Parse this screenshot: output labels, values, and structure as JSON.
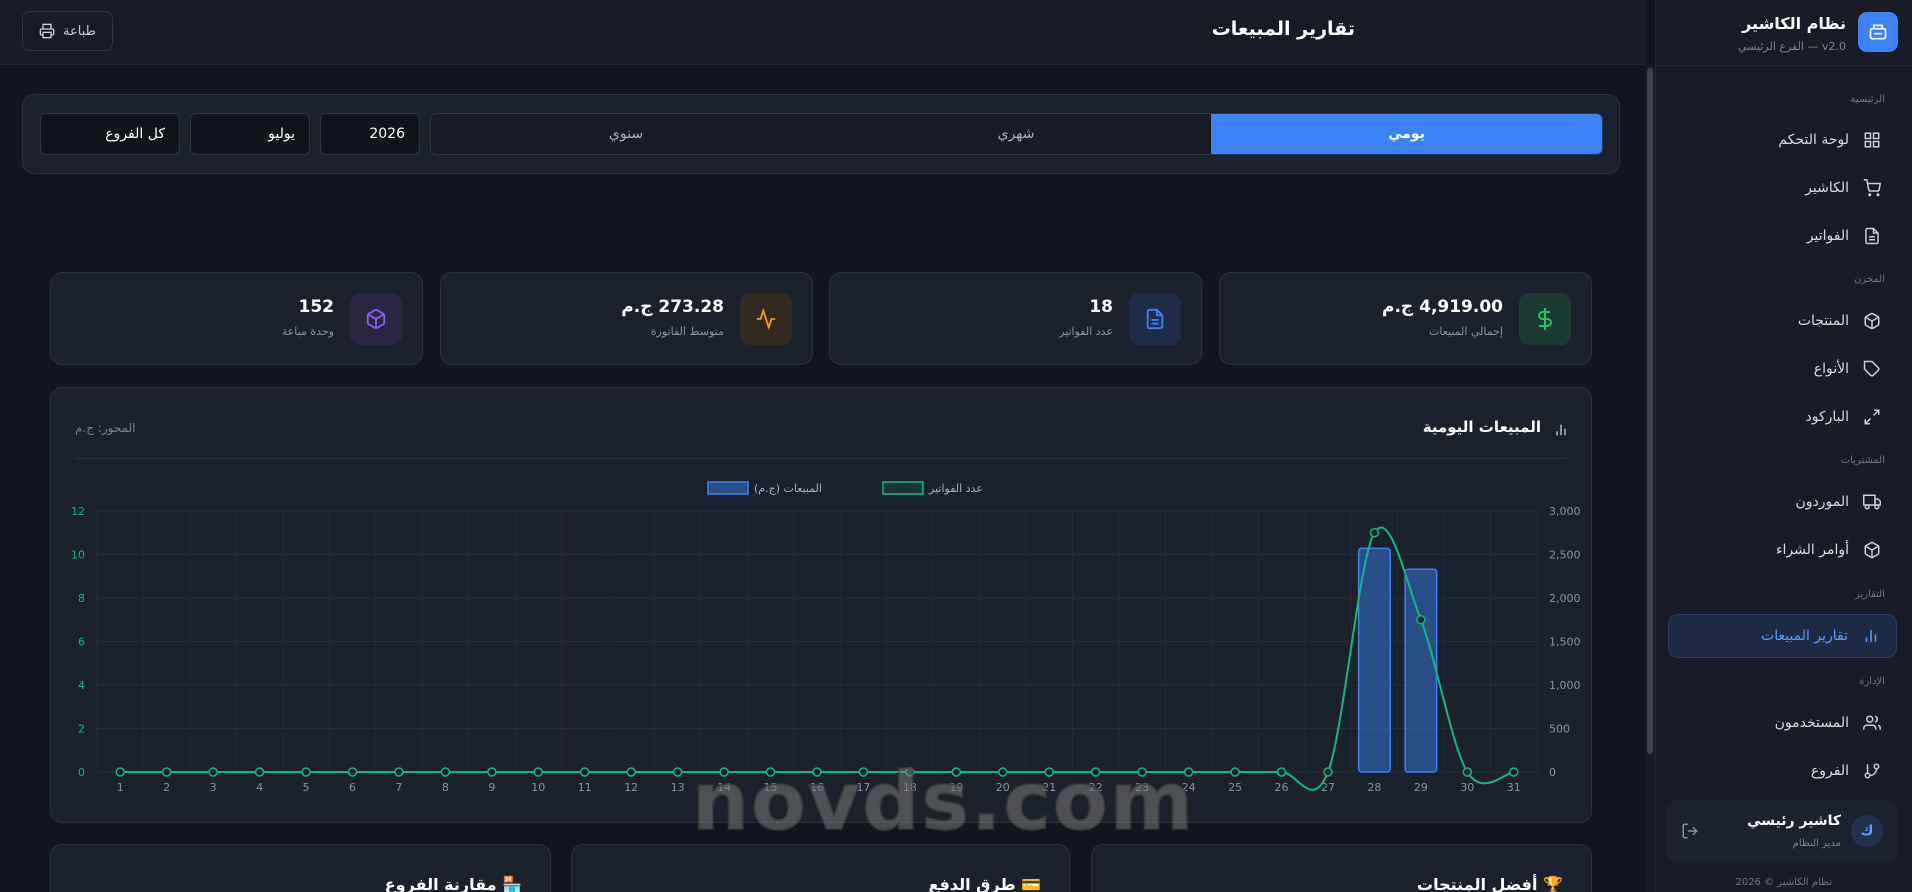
{
  "app": {
    "title": "نظام الكاشير",
    "subtitle": "v2.0 — الفرع الرئيسي",
    "copyright": "نظام الكاشير © 2026"
  },
  "header": {
    "page_title": "تقارير المبيعات",
    "print_label": "طباعة"
  },
  "sidebar": {
    "sections": {
      "main": "الرئيسية",
      "warehouse": "المخزن",
      "purchases": "المشتريات",
      "reports": "التقارير",
      "admin": "الإدارة"
    },
    "items": [
      {
        "label": "لوحة التحكم",
        "icon": "grid-icon"
      },
      {
        "label": "الكاشير",
        "icon": "cart-icon"
      },
      {
        "label": "الفواتير",
        "icon": "file-icon"
      },
      {
        "label": "المنتجات",
        "icon": "box-icon"
      },
      {
        "label": "الأنواع",
        "icon": "tag-icon"
      },
      {
        "label": "الباركود",
        "icon": "expand-icon"
      },
      {
        "label": "الموردون",
        "icon": "truck-icon"
      },
      {
        "label": "أوامر الشراء",
        "icon": "package-icon"
      },
      {
        "label": "تقارير المبيعات",
        "icon": "bar-chart-icon",
        "active": true
      },
      {
        "label": "المستخدمون",
        "icon": "users-icon"
      },
      {
        "label": "الفروع",
        "icon": "branch-icon"
      }
    ],
    "user": {
      "avatar_letter": "ك",
      "name": "كاشير رئيسي",
      "role": "مدير النظام"
    }
  },
  "filters": {
    "period_options": [
      "يومي",
      "شهري",
      "سنوي"
    ],
    "selected_period": "يومي",
    "year": "2026",
    "month": "يوليو",
    "branch": "كل الفروع"
  },
  "stats": [
    {
      "value": "4,919.00 ج.م",
      "label": "إجمالي المبيعات",
      "icon": "dollar-icon",
      "color": "#22c55e"
    },
    {
      "value": "18",
      "label": "عدد الفواتير",
      "icon": "file-icon",
      "color": "#3b82f6"
    },
    {
      "value": "273.28 ج.م",
      "label": "متوسط الفاتورة",
      "icon": "activity-icon",
      "color": "#f59e0b"
    },
    {
      "value": "152",
      "label": "وحدة مباعة",
      "icon": "box-icon",
      "color": "#8b5cf6"
    }
  ],
  "chart": {
    "title": "المبيعات اليومية",
    "axis_note": "المحور: ج.م"
  },
  "chart_data": {
    "type": "bar",
    "x": [
      1,
      2,
      3,
      4,
      5,
      6,
      7,
      8,
      9,
      10,
      11,
      12,
      13,
      14,
      15,
      16,
      17,
      18,
      19,
      20,
      21,
      22,
      23,
      24,
      25,
      26,
      27,
      28,
      29,
      30,
      31
    ],
    "series": [
      {
        "name": "المبيعات (ج.م)",
        "type": "bar",
        "axis": "right",
        "color": "#3b82f6",
        "values": [
          0,
          0,
          0,
          0,
          0,
          0,
          0,
          0,
          0,
          0,
          0,
          0,
          0,
          0,
          0,
          0,
          0,
          0,
          0,
          0,
          0,
          0,
          0,
          0,
          0,
          0,
          0,
          2570,
          2330,
          0,
          0
        ]
      },
      {
        "name": "عدد الفواتير",
        "type": "line",
        "axis": "left",
        "color": "#10b981",
        "values": [
          0,
          0,
          0,
          0,
          0,
          0,
          0,
          0,
          0,
          0,
          0,
          0,
          0,
          0,
          0,
          0,
          0,
          0,
          0,
          0,
          0,
          0,
          0,
          0,
          0,
          0,
          0,
          11,
          7,
          0,
          0
        ]
      }
    ],
    "y_right": {
      "ticks": [
        "0",
        "500",
        "1,000",
        "1,500",
        "2,000",
        "2,500",
        "3,000"
      ],
      "lim": [
        0,
        3000
      ]
    },
    "y_left": {
      "ticks": [
        "0",
        "2",
        "4",
        "6",
        "8",
        "10",
        "12"
      ],
      "lim": [
        0,
        12
      ]
    },
    "legend": "top-center",
    "grid": true
  },
  "bottom_cards": [
    {
      "title": "🏆 أفضل المنتجات"
    },
    {
      "title": "💳 طرق الدفع"
    },
    {
      "title": "🏪 مقارنة الفروع"
    }
  ],
  "watermark": "novds.com"
}
